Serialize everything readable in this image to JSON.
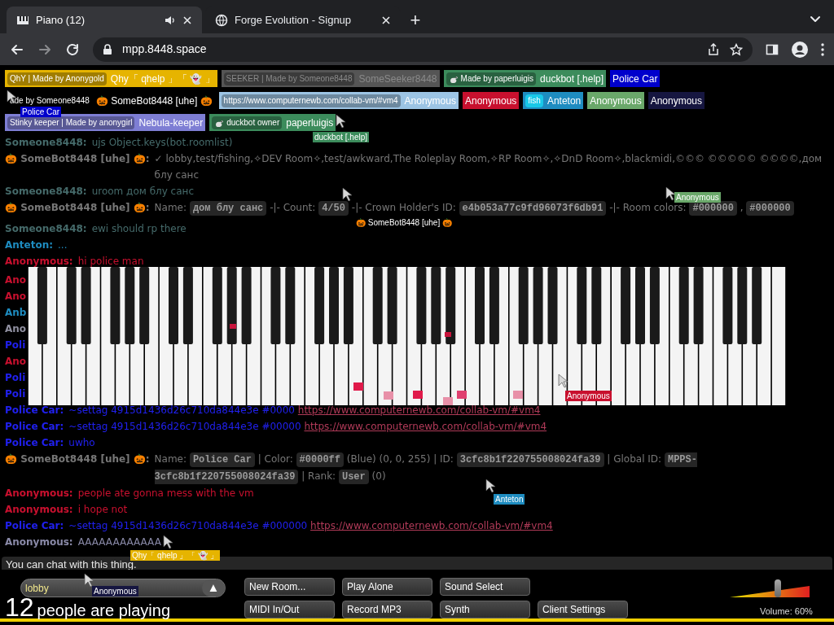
{
  "browser": {
    "tabs": [
      {
        "title": "Piano (12)",
        "selected": true,
        "kind": "audio"
      },
      {
        "title": "Forge Evolution - Signup",
        "selected": false,
        "kind": "plain"
      }
    ],
    "new_tab": "+",
    "url": "mpp.8448.space"
  },
  "players": [
    {
      "tag": "QhY | Made by Anonygold",
      "name": "Qhy「 qhelp 」「 👻 」",
      "color": "#e6b400",
      "kind": "tagged",
      "away": false
    },
    {
      "tag": "SEEKER | Made by Someone8448",
      "name": "SomeSeeker8448",
      "color": "#555555",
      "kind": "tagged",
      "away": true
    },
    {
      "tag": "Made by paperluigis",
      "name": "duckbot [.help]",
      "color": "#3c8c5c",
      "kind": "tagged-icon",
      "away": false
    },
    {
      "name": "Police Car",
      "color": "#0000cc",
      "kind": "plain",
      "away": false
    },
    {
      "tag": "ade by Someone8448",
      "name": "🎃 SomeBot8448 [uhe] 🎃",
      "color": "#000000",
      "kind": "tagged",
      "away": false
    },
    {
      "tag": "https://www.computernewb.com/collab-vm/#vm4",
      "name": "Anonymous",
      "color": "#9cc4e4",
      "kind": "tagged",
      "away": false
    },
    {
      "name": "Anonymous",
      "color": "#c8102e",
      "kind": "plain",
      "away": false
    },
    {
      "tag": "fish",
      "name": "Anteton",
      "color": "#1e8cc0",
      "kind": "tagged",
      "away": false
    },
    {
      "name": "Anonymous",
      "color": "#6aa86a",
      "kind": "plain",
      "away": false
    },
    {
      "name": "Anonymous",
      "color": "#161640",
      "kind": "plain",
      "away": false
    },
    {
      "tag": "Stinky keeper | Made by anonygirl",
      "name": "Nebula-keeper",
      "color": "#7e7ed4",
      "kind": "tagged",
      "away": false
    },
    {
      "tag": "duckbot owner",
      "name": "paperluigis",
      "color": "#3c8c5c",
      "kind": "tagged-icon",
      "away": false
    }
  ],
  "chat": [
    {
      "name": "Someone8448:",
      "color": "#456a6a",
      "parts": [
        {
          "kind": "text",
          "text": "ujs Object.keys(bot.roomlist)"
        }
      ]
    },
    {
      "name": "🎃 SomeBot8448 [uhe] 🎃:",
      "color": "#777777",
      "parts": [
        {
          "kind": "text",
          "text": "✓ lobby,test/fishing,✧DEV Room✧,test/awkward,The Roleplay Room,✧RP Room✧,✧DnD Room✧,blackmidi,©©© ©©©©© ©©©©,дом блу санс"
        }
      ]
    },
    {
      "name": "Someone8448:",
      "color": "#456a6a",
      "parts": [
        {
          "kind": "text",
          "text": "uroom дом блу санс"
        }
      ]
    },
    {
      "name": "🎃 SomeBot8448 [uhe] 🎃:",
      "color": "#777777",
      "parts": [
        {
          "kind": "text",
          "text": "Name:"
        },
        {
          "kind": "code",
          "text": "дом блу санс"
        },
        {
          "kind": "text",
          "text": "-|- Count:"
        },
        {
          "kind": "code",
          "text": "4/50"
        },
        {
          "kind": "text",
          "text": "-|- Crown Holder's ID:"
        },
        {
          "kind": "code",
          "text": "e4b053a77c9fd96073f6db91"
        },
        {
          "kind": "text",
          "text": "-|- Room colors:"
        },
        {
          "kind": "code",
          "text": "#000000"
        },
        {
          "kind": "text",
          "text": ","
        },
        {
          "kind": "code",
          "text": "#000000"
        }
      ]
    },
    {
      "name": "Someone8448:",
      "color": "#456a6a",
      "parts": [
        {
          "kind": "text",
          "text": "ewi should rp there"
        }
      ]
    },
    {
      "name": "Anteton:",
      "color": "#1e8cc0",
      "parts": [
        {
          "kind": "text",
          "text": "..."
        }
      ]
    },
    {
      "name": "Anonymous:",
      "color": "#c8102e",
      "parts": [
        {
          "kind": "text",
          "text": "hi police man"
        }
      ]
    },
    {
      "name": "Ano",
      "color": "#c8102e"
    },
    {
      "name": "Ano",
      "color": "#c8102e"
    },
    {
      "name": "Anb",
      "color": "#1e8cc0"
    },
    {
      "name": "Ano",
      "color": "#9090a0"
    },
    {
      "name": "Poli",
      "color": "#2020ee"
    },
    {
      "name": "Ano",
      "color": "#c8102e"
    },
    {
      "name": "Poli",
      "color": "#2020ee"
    },
    {
      "name": "Poli",
      "color": "#2020ee"
    },
    {
      "name": "Police Car:",
      "color": "#2020ee",
      "parts": [
        {
          "kind": "text",
          "text": "~settag 4915d1436d26c710da844e3e #0000"
        },
        {
          "kind": "link",
          "text": "https://www.computernewb.com/collab-vm/#vm4"
        }
      ]
    },
    {
      "name": "Police Car:",
      "color": "#2020ee",
      "parts": [
        {
          "kind": "text",
          "text": "~settag 4915d1436d26c710da844e3e #00000"
        },
        {
          "kind": "link",
          "text": "https://www.computernewb.com/collab-vm/#vm4"
        }
      ]
    },
    {
      "name": "Police Car:",
      "color": "#2020ee",
      "parts": [
        {
          "kind": "text",
          "text": "uwho"
        }
      ]
    },
    {
      "name": "🎃 SomeBot8448 [uhe] 🎃:",
      "color": "#777777",
      "parts": [
        {
          "kind": "text",
          "text": "Name:"
        },
        {
          "kind": "code",
          "text": "Police Car"
        },
        {
          "kind": "text",
          "text": "| Color:"
        },
        {
          "kind": "code",
          "text": "#0000ff"
        },
        {
          "kind": "text",
          "text": "(Blue) (0, 0, 255) | ID:"
        },
        {
          "kind": "code",
          "text": "3cfc8b1f220755008024fa39"
        },
        {
          "kind": "text",
          "text": "| Global ID:"
        },
        {
          "kind": "code",
          "text": "MPPS-3cfc8b1f220755008024fa39"
        },
        {
          "kind": "text",
          "text": "| Rank:"
        },
        {
          "kind": "code",
          "text": "User"
        },
        {
          "kind": "text",
          "text": "(0)"
        }
      ]
    },
    {
      "name": "Anonymous:",
      "color": "#c8102e",
      "parts": [
        {
          "kind": "text",
          "text": "people ate gonna mess with the vm"
        }
      ]
    },
    {
      "name": "Anonymous:",
      "color": "#c8102e",
      "parts": [
        {
          "kind": "text",
          "text": "i hope not"
        }
      ]
    },
    {
      "name": "Police Car:",
      "color": "#2020ee",
      "parts": [
        {
          "kind": "text",
          "text": "~settag 4915d1436d26c710da844e3e #000000"
        },
        {
          "kind": "link",
          "text": "https://www.computernewb.com/collab-vm/#vm4"
        }
      ]
    },
    {
      "name": "Anonymous:",
      "color": "#8a8aa8",
      "parts": [
        {
          "kind": "text",
          "text": "AAAAAAAAAAAA"
        }
      ]
    }
  ],
  "chat_input": {
    "placeholder": "You can chat with this thing."
  },
  "cursors": [
    {
      "name": "Police Car",
      "color": "#0000cc"
    },
    {
      "name": "duckbot [.help]",
      "color": "#3c8c5c"
    },
    {
      "name": "🎃 SomeBot8448 [uhe] 🎃",
      "color": "#000000"
    },
    {
      "name": "Anonymous",
      "color": "#6aa86a"
    },
    {
      "name": "Anonymous",
      "color": "#c8102e"
    },
    {
      "name": "Anteton",
      "color": "#1e8cc0"
    },
    {
      "name": "Qhy「 qhelp 」「 👻 」",
      "color": "#e6b400"
    },
    {
      "name": "Anonymous",
      "color": "#161640"
    }
  ],
  "room": {
    "value": "lobby",
    "toggle": "▲"
  },
  "count": {
    "number": "12",
    "label": "people are playing"
  },
  "buttons": [
    [
      "New Room...",
      "Play Alone",
      "Sound Select"
    ],
    [
      "MIDI In/Out",
      "Record MP3",
      "Synth",
      "Client Settings"
    ]
  ],
  "volume": {
    "level": 0.6,
    "label": "Volume: 60%"
  }
}
